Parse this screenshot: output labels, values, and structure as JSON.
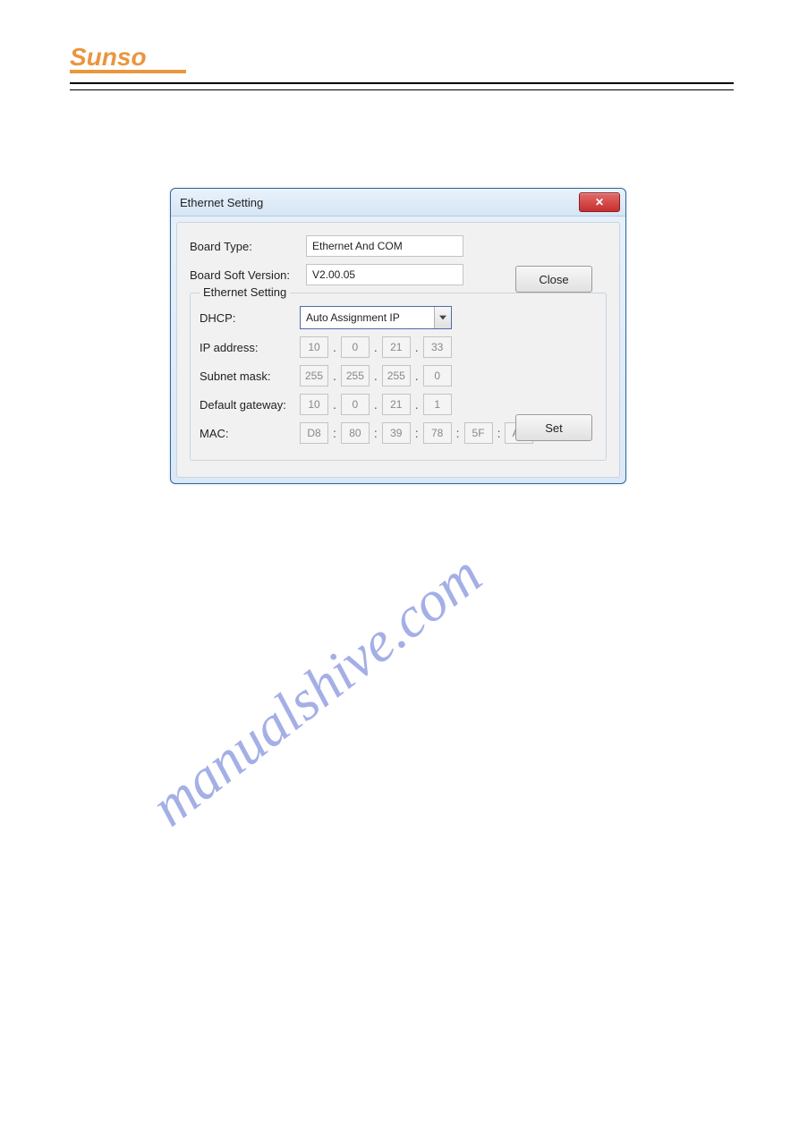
{
  "logo": {
    "text": "Sunso"
  },
  "watermark": "manualshive.com",
  "dialog": {
    "title": "Ethernet Setting",
    "board_type_label": "Board Type:",
    "board_type_value": "Ethernet And COM",
    "board_soft_version_label": "Board Soft Version:",
    "board_soft_version_value": "V2.00.05",
    "close_label": "Close",
    "set_label": "Set",
    "group_title": "Ethernet Setting",
    "dhcp_label": "DHCP:",
    "dhcp_selected": "Auto Assignment IP",
    "ip_label": "IP address:",
    "ip": [
      "10",
      "0",
      "21",
      "33"
    ],
    "subnet_label": "Subnet mask:",
    "subnet": [
      "255",
      "255",
      "255",
      "0"
    ],
    "gateway_label": "Default gateway:",
    "gateway": [
      "10",
      "0",
      "21",
      "1"
    ],
    "mac_label": "MAC:",
    "mac": [
      "D8",
      "80",
      "39",
      "78",
      "5F",
      "AA"
    ],
    "dot": ".",
    "colon": ":"
  }
}
